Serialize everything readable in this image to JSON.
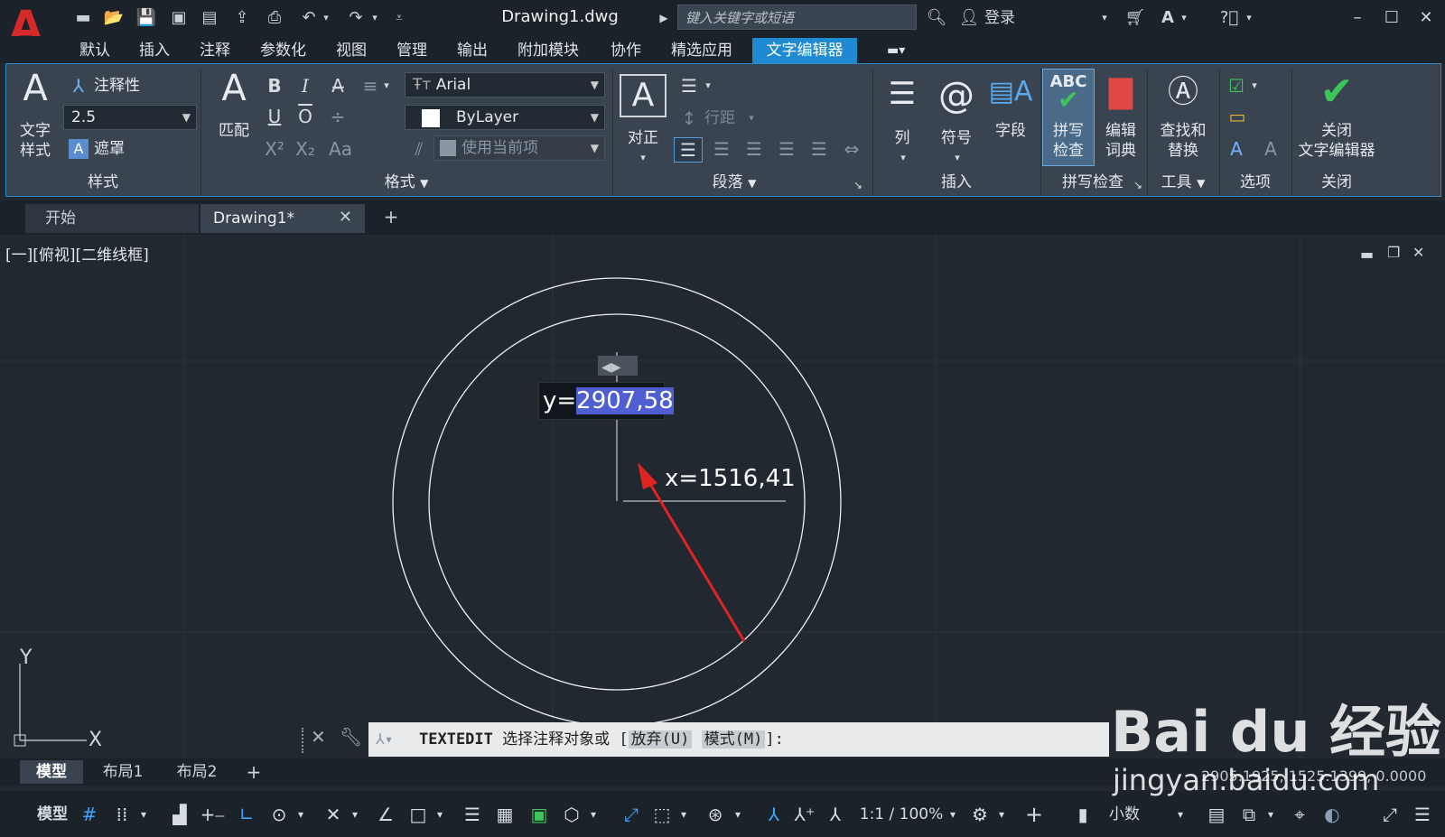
{
  "app": {
    "logo": "A",
    "doc_title": "Drawing1.dwg",
    "search_placeholder": "键入关键字或短语",
    "login": "登录"
  },
  "menu": {
    "items": [
      "默认",
      "插入",
      "注释",
      "参数化",
      "视图",
      "管理",
      "输出",
      "附加模块",
      "协作",
      "精选应用"
    ],
    "active": "文字编辑器"
  },
  "ribbon": {
    "style_panel": {
      "title": "样式",
      "text_style": "文字\n样式",
      "annotative": "注释性",
      "height": "2.5",
      "mask": "遮罩"
    },
    "format_panel": {
      "title": "格式",
      "match": "匹配",
      "font": "Arial",
      "color": "ByLayer",
      "bg": "使用当前项",
      "bold": "B",
      "italic": "I",
      "underline": "U",
      "overline": "O"
    },
    "paragraph_panel": {
      "title": "段落",
      "justify": "对正",
      "line_spacing": "行距"
    },
    "insert_panel": {
      "title": "插入",
      "columns": "列",
      "symbol": "符号",
      "field": "字段"
    },
    "spell_panel": {
      "title": "拼写检查",
      "spell": "拼写\n检查",
      "dict": "编辑\n词典"
    },
    "tools_panel": {
      "title": "工具",
      "find": "查找和\n替换"
    },
    "options_panel": {
      "title": "选项"
    },
    "close_panel": {
      "title": "关闭",
      "close": "关闭\n文字编辑器"
    }
  },
  "tabs": {
    "start": "开始",
    "drawing": "Drawing1*"
  },
  "view_label": "[一][俯视][二维线框]",
  "dyn_input": {
    "y_prefix": "y=",
    "y_value": "2907,58",
    "x_text": "x=1516,41"
  },
  "command": {
    "name": "TEXTEDIT",
    "prompt": "选择注释对象或",
    "bracket_open": "[",
    "opt1": "放弃(U)",
    "opt2": "模式(M)",
    "bracket_close": "]:"
  },
  "layout_tabs": [
    "模型",
    "布局1",
    "布局2"
  ],
  "coords": "2905.1925, 1525.1399, 0.0000",
  "status": {
    "model": "模型",
    "scale": "1:1 / 100%",
    "units": "小数"
  },
  "watermark": {
    "brand": "Bai du 经验",
    "url": "jingyan.baidu.com"
  },
  "colors": {
    "accent": "#1f8ad2",
    "arrow": "#e02424",
    "check": "#3cc65a"
  }
}
